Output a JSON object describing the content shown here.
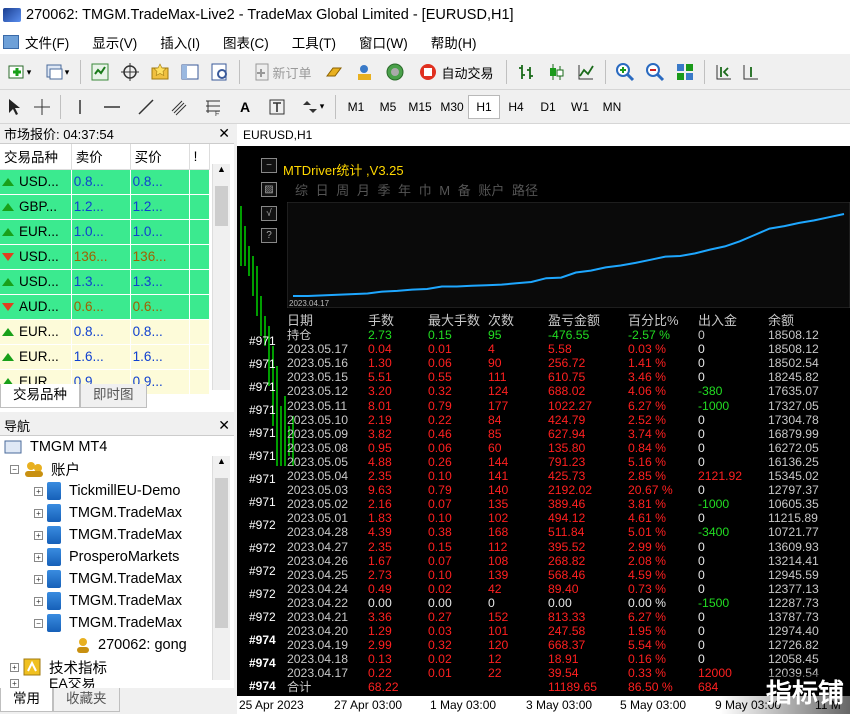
{
  "window": {
    "title": "270062: TMGM.TradeMax-Live2 - TradeMax Global Limited - [EURUSD,H1]"
  },
  "menu": [
    "文件(F)",
    "显示(V)",
    "插入(I)",
    "图表(C)",
    "工具(T)",
    "窗口(W)",
    "帮助(H)"
  ],
  "toolbar": {
    "new_order": "新订单",
    "auto_trade": "自动交易"
  },
  "timeframes": [
    "M1",
    "M5",
    "M15",
    "M30",
    "H1",
    "H4",
    "D1",
    "W1",
    "MN"
  ],
  "timeframe_selected": "H1",
  "market_watch": {
    "title": "市场报价: 04:37:54",
    "columns": [
      "交易品种",
      "卖价",
      "买价",
      "!"
    ],
    "rows": [
      {
        "symbol": "USD...",
        "bid": "0.8...",
        "ask": "0.8...",
        "dir": "up",
        "bg": "green"
      },
      {
        "symbol": "GBP...",
        "bid": "1.2...",
        "ask": "1.2...",
        "dir": "up",
        "bg": "green"
      },
      {
        "symbol": "EUR...",
        "bid": "1.0...",
        "ask": "1.0...",
        "dir": "up",
        "bg": "green"
      },
      {
        "symbol": "USD...",
        "bid": "136...",
        "ask": "136...",
        "dir": "down",
        "bg": "green"
      },
      {
        "symbol": "USD...",
        "bid": "1.3...",
        "ask": "1.3...",
        "dir": "up",
        "bg": "green"
      },
      {
        "symbol": "AUD...",
        "bid": "0.6...",
        "ask": "0.6...",
        "dir": "down",
        "bg": "green"
      },
      {
        "symbol": "EUR...",
        "bid": "0.8...",
        "ask": "0.8...",
        "dir": "up",
        "bg": "yellow"
      },
      {
        "symbol": "EUR...",
        "bid": "1.6...",
        "ask": "1.6...",
        "dir": "up",
        "bg": "yellow"
      },
      {
        "symbol": "EUR...",
        "bid": "0.9...",
        "ask": "0.9...",
        "dir": "up",
        "bg": "yellow"
      }
    ],
    "tabs": [
      "交易品种",
      "即时图"
    ]
  },
  "navigator": {
    "title": "导航",
    "root": "TMGM MT4",
    "accounts_label": "账户",
    "accounts": [
      "TickmillEU-Demo",
      "TMGM.TradeMax",
      "TMGM.TradeMax",
      "ProsperoMarkets",
      "TMGM.TradeMax",
      "TMGM.TradeMax",
      "TMGM.TradeMax"
    ],
    "sub_account": "270062: gong",
    "indicators": "技术指标",
    "partial_next": "EA交易",
    "tabs": [
      "常用",
      "收藏夹"
    ]
  },
  "chart": {
    "symbol_label": "EURUSD,H1",
    "overlay_title": "MTDriver统计 ,V3.25",
    "overlay_tabs": "综 日 周 月 季 年 巾 M 备 账户      路径",
    "equity_start_date": "2023.04.17",
    "chart_data": {
      "type": "line",
      "series": [
        {
          "values": [
            5600,
            5600,
            5700,
            5800,
            5900,
            6000,
            6300,
            6400,
            6600,
            6700,
            7100,
            7100,
            7200,
            7300,
            7400,
            7600,
            7800,
            8400,
            8500,
            9300,
            9600,
            10100,
            10400,
            10800,
            11300,
            11800,
            11900,
            12300,
            12900,
            13400,
            14200,
            15200,
            16200,
            16600,
            17100,
            17500,
            18000,
            18500
          ]
        }
      ]
    },
    "stats": {
      "headers": [
        "日期",
        "手数",
        "最大手数",
        "次数",
        "盈亏金额",
        "百分比%",
        "出入金",
        "余额"
      ],
      "holding": [
        "持仓",
        "2.73",
        "0.15",
        "95",
        "-476.55",
        "-2.57 %",
        "0",
        "18508.12"
      ],
      "rows": [
        [
          "2023.05.17",
          "0.04",
          "0.01",
          "4",
          "5.58",
          "0.03 %",
          "0",
          "18508.12"
        ],
        [
          "2023.05.16",
          "1.30",
          "0.06",
          "90",
          "256.72",
          "1.41 %",
          "0",
          "18502.54"
        ],
        [
          "2023.05.15",
          "5.51",
          "0.55",
          "111",
          "610.75",
          "3.46 %",
          "0",
          "18245.82"
        ],
        [
          "2023.05.12",
          "3.20",
          "0.32",
          "124",
          "688.02",
          "4.06 %",
          "-380",
          "17635.07"
        ],
        [
          "2023.05.11",
          "8.01",
          "0.79",
          "177",
          "1022.27",
          "6.27 %",
          "-1000",
          "17327.05"
        ],
        [
          "2023.05.10",
          "2.19",
          "0.22",
          "84",
          "424.79",
          "2.52 %",
          "0",
          "17304.78"
        ],
        [
          "2023.05.09",
          "3.82",
          "0.46",
          "85",
          "627.94",
          "3.74 %",
          "0",
          "16879.99"
        ],
        [
          "2023.05.08",
          "0.95",
          "0.06",
          "60",
          "135.80",
          "0.84 %",
          "0",
          "16272.05"
        ],
        [
          "2023.05.05",
          "4.88",
          "0.26",
          "144",
          "791.23",
          "5.16 %",
          "0",
          "16136.25"
        ],
        [
          "2023.05.04",
          "2.35",
          "0.10",
          "141",
          "425.73",
          "2.85 %",
          "2121.92",
          "15345.02"
        ],
        [
          "2023.05.03",
          "9.63",
          "0.79",
          "140",
          "2192.02",
          "20.67 %",
          "0",
          "12797.37"
        ],
        [
          "2023.05.02",
          "2.16",
          "0.07",
          "135",
          "389.46",
          "3.81 %",
          "-1000",
          "10605.35"
        ],
        [
          "2023.05.01",
          "1.83",
          "0.10",
          "102",
          "494.12",
          "4.61 %",
          "0",
          "11215.89"
        ],
        [
          "2023.04.28",
          "4.39",
          "0.38",
          "168",
          "511.84",
          "5.01 %",
          "-3400",
          "10721.77"
        ],
        [
          "2023.04.27",
          "2.35",
          "0.15",
          "112",
          "395.52",
          "2.99 %",
          "0",
          "13609.93"
        ],
        [
          "2023.04.26",
          "1.67",
          "0.07",
          "108",
          "268.82",
          "2.08 %",
          "0",
          "13214.41"
        ],
        [
          "2023.04.25",
          "2.73",
          "0.10",
          "139",
          "568.46",
          "4.59 %",
          "0",
          "12945.59"
        ],
        [
          "2023.04.24",
          "0.49",
          "0.02",
          "42",
          "89.40",
          "0.73 %",
          "0",
          "12377.13"
        ],
        [
          "2023.04.22",
          "0.00",
          "0.00",
          "0",
          "0.00",
          "0.00 %",
          "-1500",
          "12287.73"
        ],
        [
          "2023.04.21",
          "3.36",
          "0.27",
          "152",
          "813.33",
          "6.27 %",
          "0",
          "13787.73"
        ],
        [
          "2023.04.20",
          "1.29",
          "0.03",
          "101",
          "247.58",
          "1.95 %",
          "0",
          "12974.40"
        ],
        [
          "2023.04.19",
          "2.99",
          "0.32",
          "120",
          "668.37",
          "5.54 %",
          "0",
          "12726.82"
        ],
        [
          "2023.04.18",
          "0.13",
          "0.02",
          "12",
          "18.91",
          "0.16 %",
          "0",
          "12058.45"
        ],
        [
          "2023.04.17",
          "0.22",
          "0.01",
          "22",
          "39.54",
          "0.33 %",
          "12000",
          "12039.54"
        ]
      ],
      "total": [
        "合计",
        "68.22",
        "",
        "",
        "11189.65",
        "86.50 %",
        "684"
      ]
    },
    "y_labels": [
      "#971",
      "#971",
      "#971",
      "#971",
      "#971",
      "#971",
      "#971",
      "#971",
      "#972",
      "#972",
      "#972",
      "#972",
      "#972",
      "#974",
      "#974",
      "#974"
    ],
    "x_labels": [
      "25 Apr 2023",
      "27 Apr 03:00",
      "1 May 03:00",
      "3 May 03:00",
      "5 May 03:00",
      "9 May 03:00",
      "11 M"
    ],
    "watermark": "指标铺"
  }
}
